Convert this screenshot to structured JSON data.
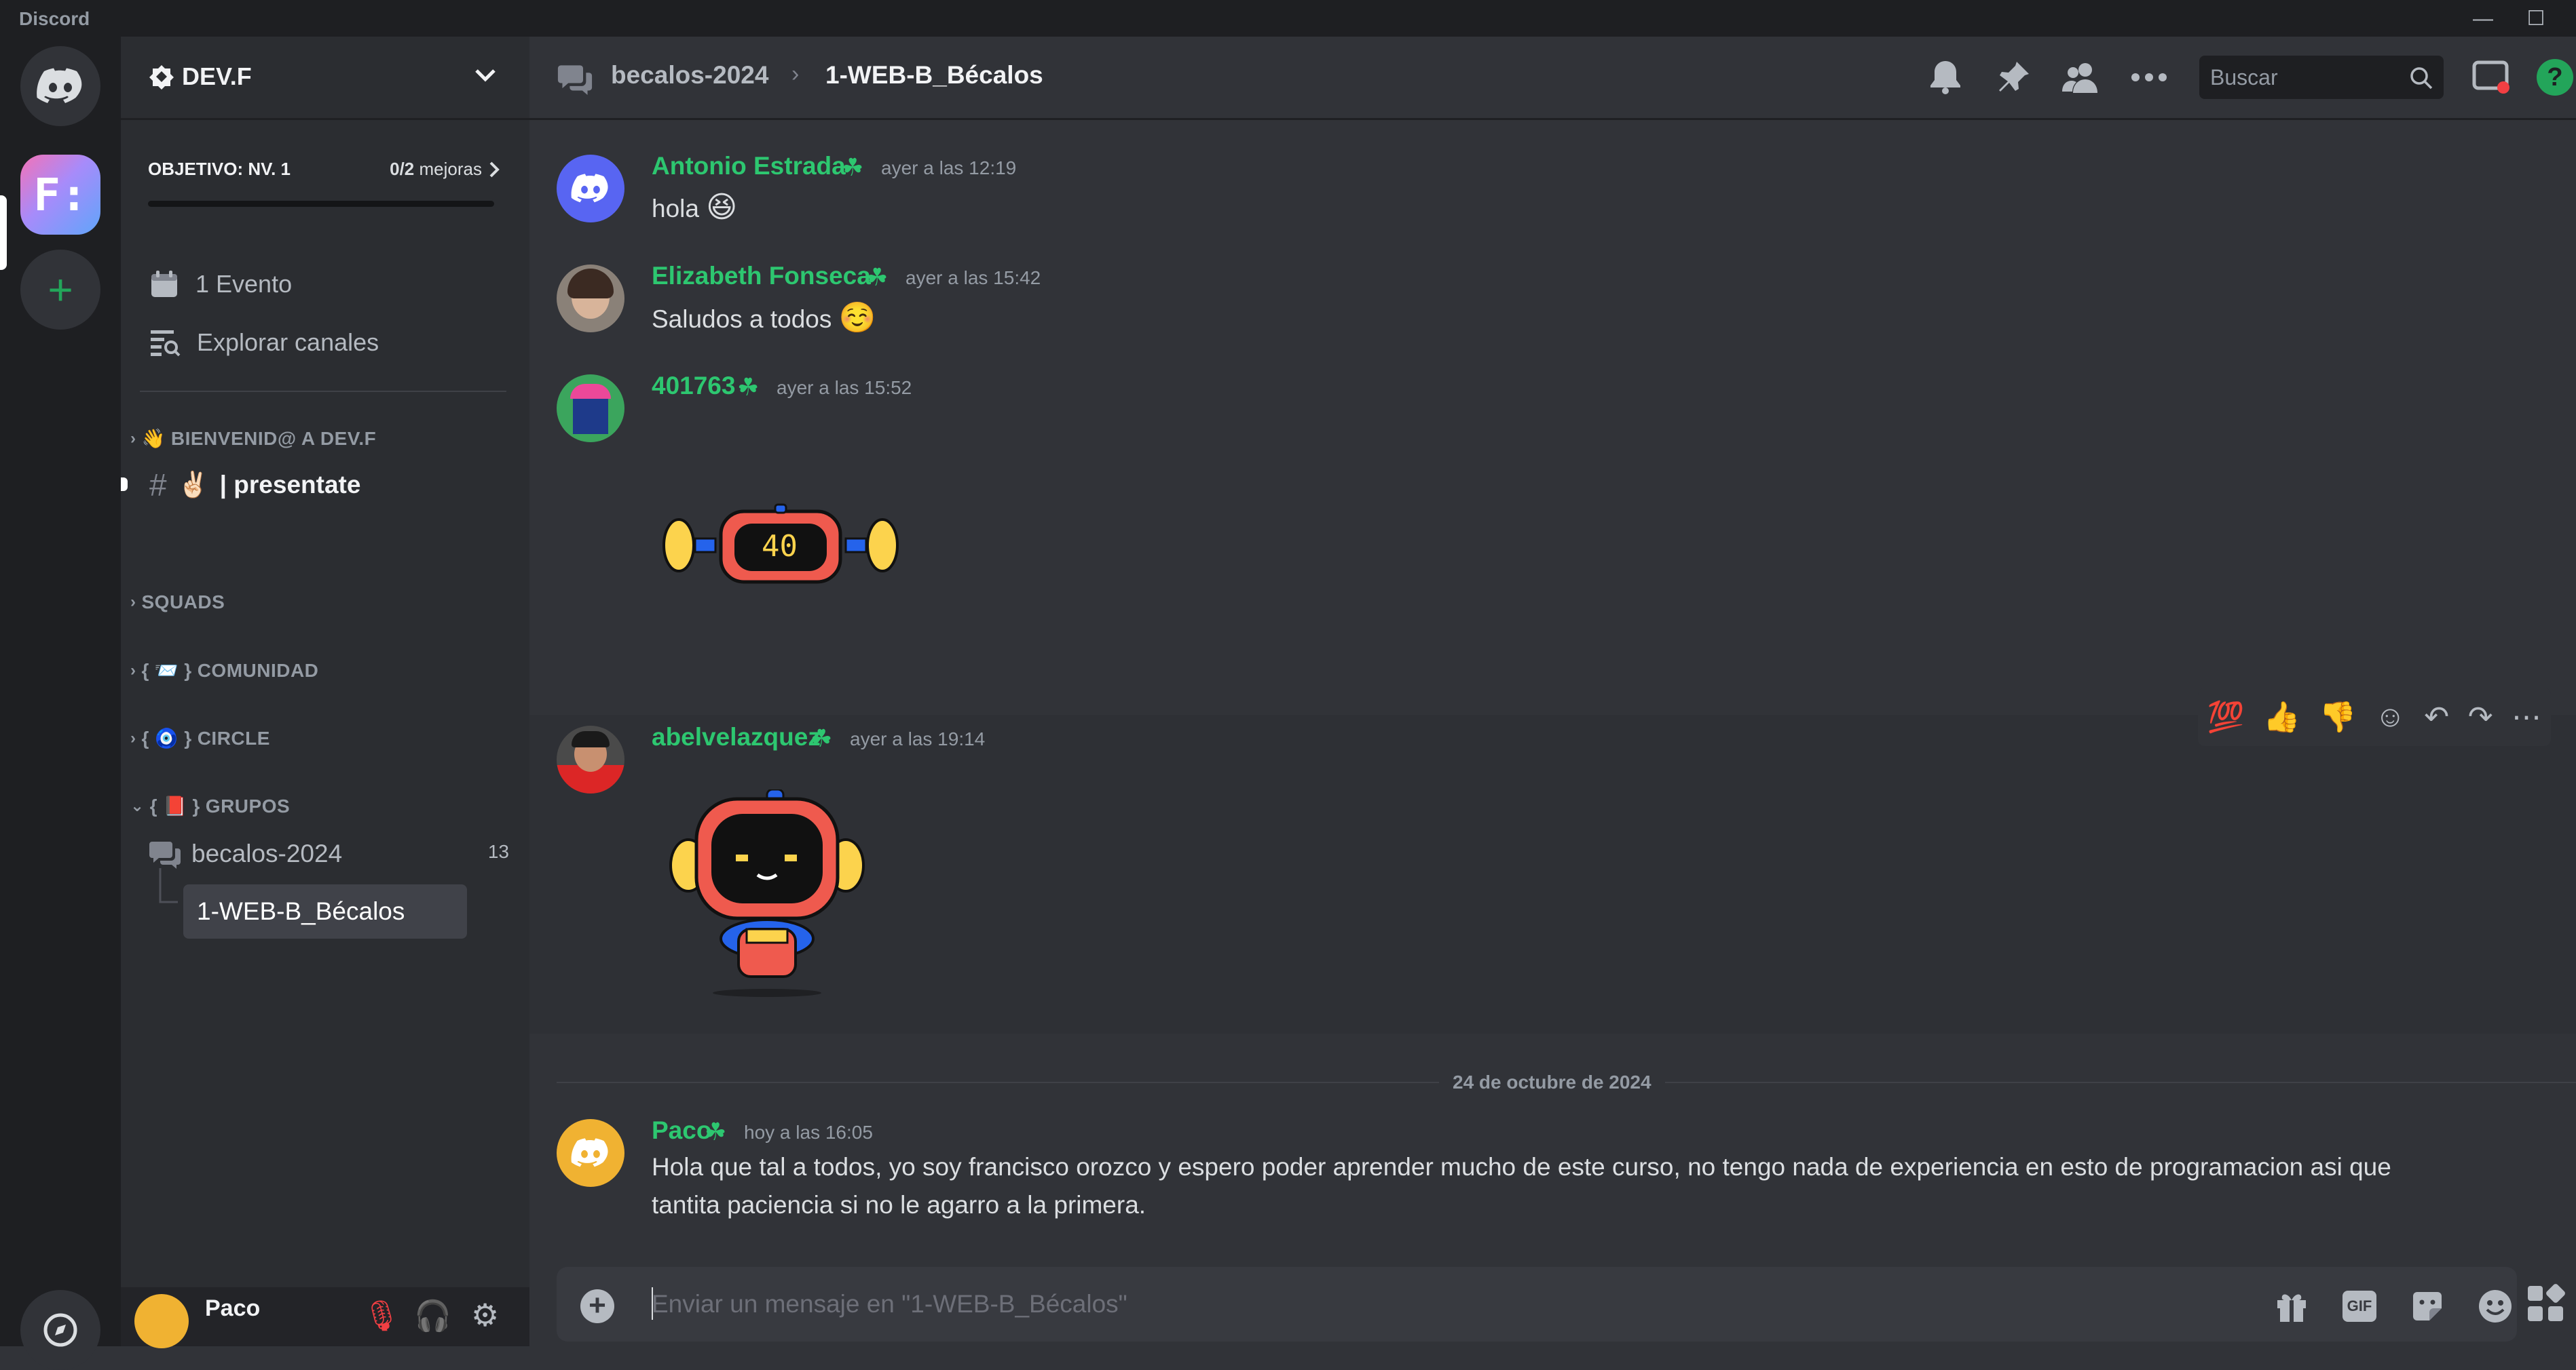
{
  "titlebar": {
    "app_name": "Discord",
    "minimize": "—",
    "maximize": "☐"
  },
  "servers": {
    "home_label": "Discord",
    "devf_initials": "F:",
    "add_label": "+"
  },
  "guild": {
    "name": "DEV.F",
    "goal": {
      "title": "OBJETIVO: NV. 1",
      "count": "0/2",
      "count_suffix": "mejoras",
      "progress": 0
    },
    "items": [
      {
        "icon": "calendar-icon",
        "label": "1 Evento"
      },
      {
        "icon": "browse-channels-icon",
        "label": "Explorar canales"
      }
    ],
    "categories": [
      {
        "emoji": "👋",
        "name": "BIENVENID@ A DEV.F",
        "collapsed": true
      },
      {
        "emoji": "",
        "name": "SQUADS",
        "collapsed": true
      },
      {
        "emoji": "📨",
        "name": "COMUNIDAD",
        "collapsed": true,
        "prefix": "{",
        "suffix": "}"
      },
      {
        "emoji": "🧿",
        "name": "CIRCLE",
        "collapsed": true,
        "prefix": "{",
        "suffix": "}"
      },
      {
        "emoji": "📕",
        "name": "GRUPOS",
        "collapsed": false,
        "prefix": "{",
        "suffix": "}"
      }
    ],
    "channels": {
      "presentate": {
        "emoji": "✌🏻",
        "name": "| presentate"
      },
      "forum": {
        "name": "becalos-2024",
        "count": "13"
      },
      "thread": {
        "name": "1-WEB-B_Bécalos"
      }
    }
  },
  "user": {
    "name": "Paco"
  },
  "header": {
    "parent": "becalos-2024",
    "separator": "›",
    "thread": "1-WEB-B_Bécalos",
    "search_placeholder": "Buscar",
    "help": "?"
  },
  "messages": [
    {
      "author": "Antonio Estrada",
      "time": "ayer a las 12:19",
      "text": "hola",
      "emoji": "😆"
    },
    {
      "author": "Elizabeth Fonseca",
      "time": "ayer a las 15:42",
      "text": "Saludos a todos",
      "emoji": "☺️"
    },
    {
      "author": "401763",
      "time": "ayer a las 15:52",
      "sticker_text": "40"
    },
    {
      "author": "abelvelazquez",
      "time": "ayer a las 19:14"
    },
    {
      "author": "Paco",
      "time": "hoy a las 16:05",
      "text_line1": "Hola que tal a todos, yo soy francisco orozco y espero poder aprender mucho de este curso, no tengo nada de experiencia en esto de programacion asi que",
      "text_line2": "tantita paciencia si no le agarro a la primera."
    }
  ],
  "reactions": [
    "💯",
    "👍",
    "👎"
  ],
  "date_separator": "24 de octubre de 2024",
  "composer": {
    "placeholder": "Enviar un mensaje en \"1-WEB-B_Bécalos\"",
    "gif": "GIF"
  },
  "colors": {
    "accent_green": "#2dc770",
    "background": "#313338",
    "sidebar": "#2b2d31",
    "blurple": "#5865f2"
  }
}
